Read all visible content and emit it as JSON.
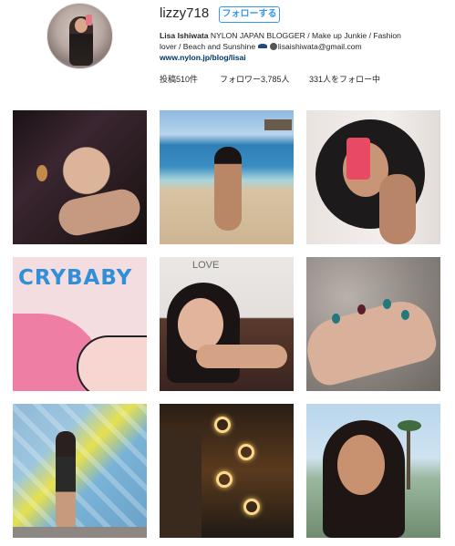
{
  "profile": {
    "username": "lizzy718",
    "follow_button": "フォローする",
    "bio_name": "Lisa Ishiwata",
    "bio_line1": "NYLON JAPAN BLOGGER / Make up Junkie / Fashion",
    "bio_line2": "lover / Beach and Sunshine",
    "bio_email": "lisaishiwata@gmail.com",
    "bio_link": "www.nylon.jp/blog/lisai"
  },
  "stats": {
    "posts": "投稿510件",
    "followers": "フォロワー3,785人",
    "following": "331人をフォロー中"
  },
  "grid": {
    "tile4_text": "CRYBABY",
    "tile5_text": "LOVE"
  },
  "colors": {
    "accent": "#3897f0",
    "link": "#003569",
    "text": "#262626"
  }
}
